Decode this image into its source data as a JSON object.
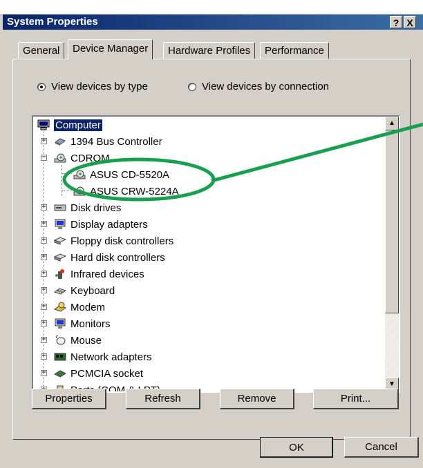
{
  "window": {
    "title": "System Properties",
    "help_btn": "?",
    "close_btn": "X"
  },
  "tabs": [
    {
      "label": "General",
      "active": false
    },
    {
      "label": "Device Manager",
      "active": true
    },
    {
      "label": "Hardware Profiles",
      "active": false
    },
    {
      "label": "Performance",
      "active": false
    }
  ],
  "view": {
    "by_type": "View devices by type",
    "by_connection": "View devices by connection",
    "selected": "by_type"
  },
  "tree": {
    "root": "Computer",
    "items": [
      {
        "label": "1394 Bus Controller",
        "icon": "bus-controller-icon"
      },
      {
        "label": "CDROM",
        "icon": "cdrom-icon"
      },
      {
        "label": "ASUS CD-5520A",
        "icon": "cdrom-drive-icon"
      },
      {
        "label": "ASUS CRW-5224A",
        "icon": "cdrom-drive-icon"
      },
      {
        "label": "Disk drives",
        "icon": "disk-drive-icon"
      },
      {
        "label": "Display adapters",
        "icon": "monitor-icon"
      },
      {
        "label": "Floppy disk controllers",
        "icon": "floppy-controller-icon"
      },
      {
        "label": "Hard disk controllers",
        "icon": "hard-disk-controller-icon"
      },
      {
        "label": "Infrared devices",
        "icon": "infrared-icon"
      },
      {
        "label": "Keyboard",
        "icon": "keyboard-icon"
      },
      {
        "label": "Modem",
        "icon": "modem-icon"
      },
      {
        "label": "Monitors",
        "icon": "monitor-icon"
      },
      {
        "label": "Mouse",
        "icon": "mouse-icon"
      },
      {
        "label": "Network adapters",
        "icon": "network-adapter-icon"
      },
      {
        "label": "PCMCIA socket",
        "icon": "pcmcia-icon"
      },
      {
        "label": "Ports (COM & LPT)",
        "icon": "port-icon"
      }
    ]
  },
  "buttons": {
    "properties": "Properties",
    "refresh": "Refresh",
    "remove": "Remove",
    "print": "Print...",
    "ok": "OK",
    "cancel": "Cancel"
  },
  "colors": {
    "face": "#d4d0c8",
    "titlebar": "#0a246a",
    "annotation": "#18a050"
  }
}
